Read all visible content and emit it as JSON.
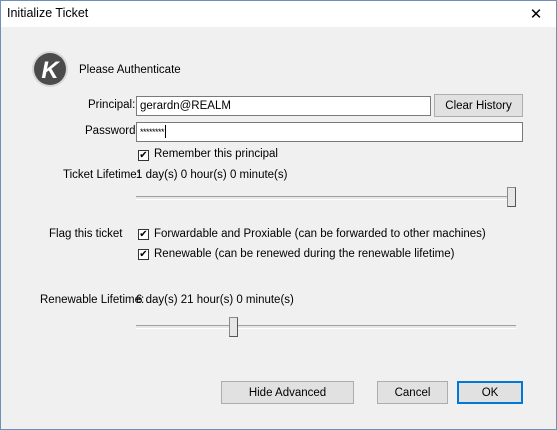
{
  "window": {
    "title": "Initialize Ticket",
    "close_glyph": "✕"
  },
  "header": {
    "prompt": "Please Authenticate",
    "logo_letter": "K",
    "logo_icon": "kerberos-logo-icon"
  },
  "principal": {
    "label": "Principal:",
    "value": "gerardn@REALM"
  },
  "password": {
    "label": "Password:",
    "value": "********"
  },
  "clear_history": {
    "label": "Clear History"
  },
  "remember": {
    "label": "Remember this principal",
    "checked": true
  },
  "ticket_lifetime": {
    "label": "Ticket Lifetime:",
    "value": "1 day(s) 0 hour(s) 0 minute(s)",
    "slider_position": 1.0
  },
  "flags": {
    "label": "Flag this ticket",
    "forwardable": {
      "label": "Forwardable and Proxiable (can be forwarded to other machines)",
      "checked": true
    },
    "renewable": {
      "label": "Renewable (can be renewed during the renewable lifetime)",
      "checked": true
    }
  },
  "renewable_lifetime": {
    "label": "Renewable Lifetime:",
    "value": "6 day(s) 21 hour(s) 0 minute(s)",
    "slider_position": 0.25
  },
  "buttons": {
    "hide_advanced": "Hide Advanced",
    "cancel": "Cancel",
    "ok": "OK"
  },
  "check_glyph": "✔"
}
